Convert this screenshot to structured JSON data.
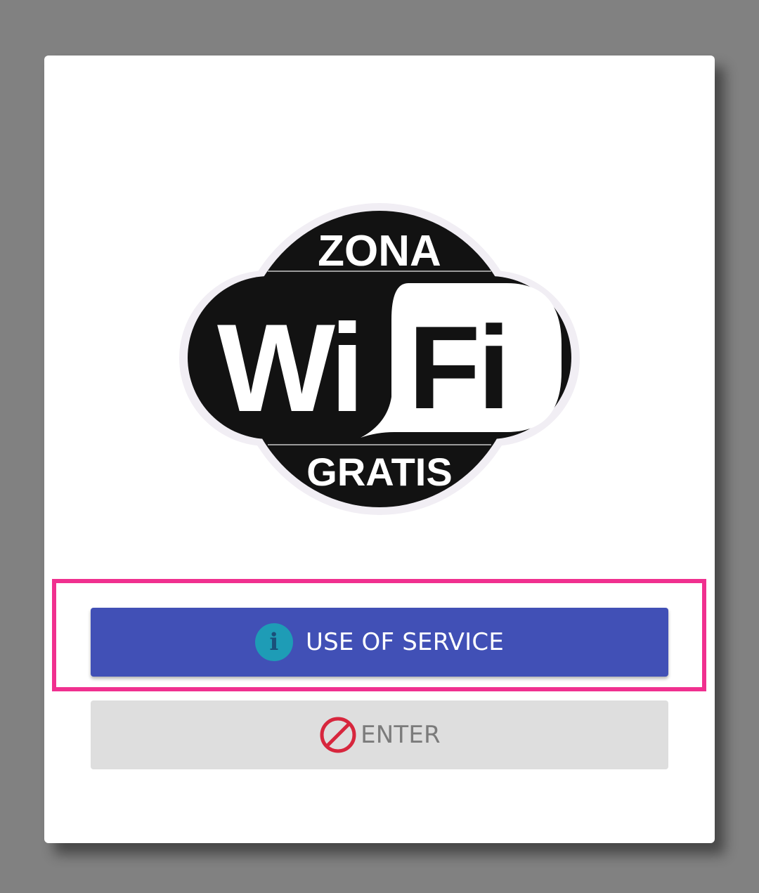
{
  "logo": {
    "top_text": "ZONA",
    "wi_text": "Wi",
    "fi_text": "Fi",
    "bottom_text": "GRATIS"
  },
  "buttons": {
    "use_of_service": {
      "label": "USE OF SERVICE",
      "icon": "info-icon",
      "color": "#4150b6",
      "icon_color": "#1e9cb6"
    },
    "enter": {
      "label": "ENTER",
      "icon": "prohibited-icon",
      "color": "#dedede",
      "icon_color": "#d7263d"
    }
  },
  "colors": {
    "highlight": "#f0308f",
    "backdrop": "#818181"
  }
}
